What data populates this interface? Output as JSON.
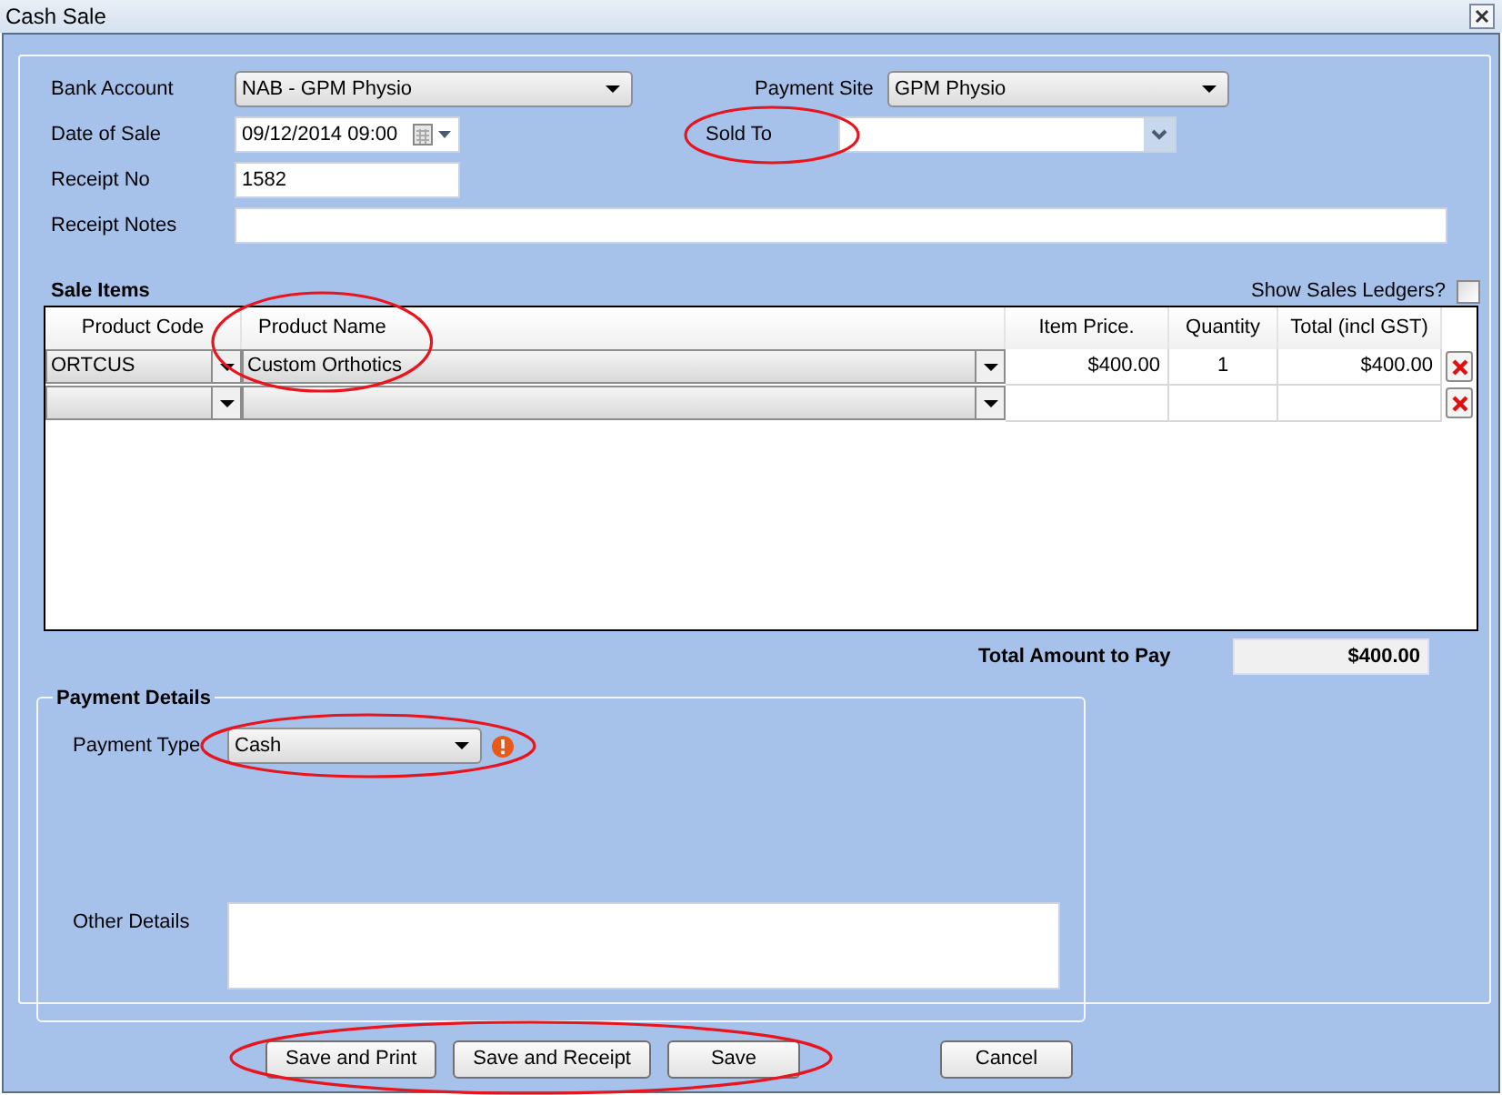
{
  "window": {
    "title": "Cash Sale"
  },
  "header_fields": [
    {
      "label": "Bank Account",
      "kind": "dropdown",
      "value": "NAB - GPM Physio",
      "circled": false
    },
    {
      "label": "Payment Site",
      "kind": "dropdown",
      "value": "GPM Physio",
      "circled": false
    },
    {
      "label": "Date of Sale",
      "kind": "date",
      "value": "09/12/2014 09:00",
      "circled": false
    },
    {
      "label": "Sold To",
      "kind": "combo",
      "circled": true
    },
    {
      "label": "Receipt No",
      "kind": "text",
      "value": "1582",
      "circled": false
    },
    {
      "label": "Receipt Notes",
      "kind": "wide",
      "circled": false
    }
  ],
  "sale_items": {
    "title": "Sale Items",
    "show_ledgers": {
      "label": "Show Sales Ledgers?",
      "checked": false
    },
    "columns": [
      {
        "label": "Product Code",
        "circled": false
      },
      {
        "label": "Product Name",
        "circled": true
      },
      {
        "label": "Item Price.",
        "circled": false
      },
      {
        "label": "Quantity",
        "circled": false
      },
      {
        "label": "Total (incl GST)",
        "circled": false
      }
    ],
    "rows": [
      {
        "code": "ORTCUS",
        "name": "Custom Orthotics",
        "price": "$400.00",
        "quantity": "1",
        "total": "$400.00"
      },
      {
        "code": "",
        "name": "",
        "price": "",
        "quantity": "",
        "total": ""
      }
    ]
  },
  "total": {
    "label": "Total Amount to Pay",
    "value": "$400.00"
  },
  "payment_details": {
    "title": "Payment Details",
    "type_label": "Payment Type",
    "type_value": "Cash",
    "type_circled": true,
    "error": true,
    "other_label": "Other Details"
  },
  "button_groups": [
    {
      "circled": true,
      "buttons": [
        "Save and Print",
        "Save and Receipt",
        "Save"
      ]
    },
    {
      "buttons": [
        "Cancel"
      ]
    }
  ]
}
